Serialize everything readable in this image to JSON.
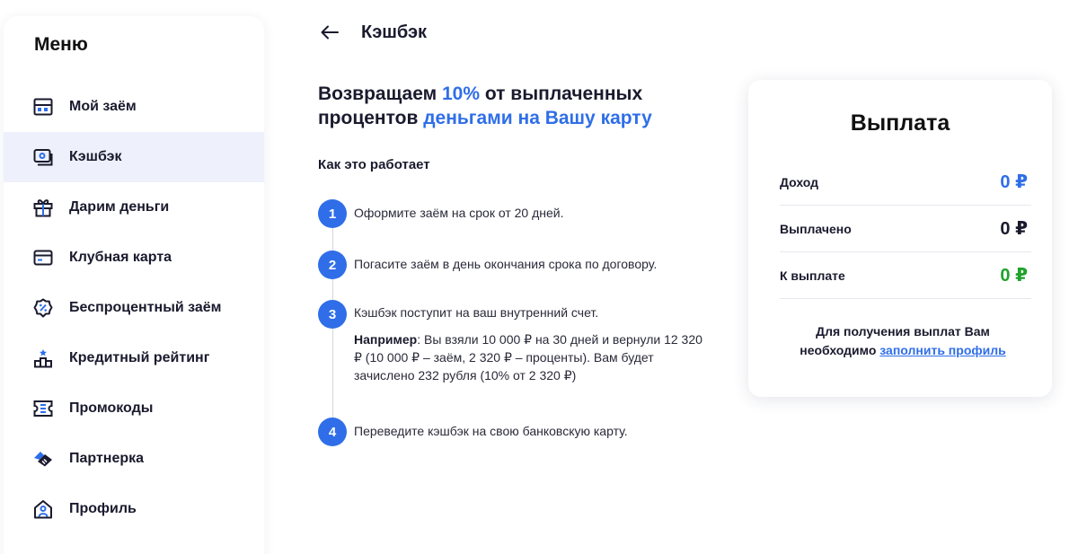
{
  "sidebar": {
    "title": "Меню",
    "items": [
      {
        "label": "Мой заём",
        "icon": "loan-icon",
        "active": false
      },
      {
        "label": "Кэшбэк",
        "icon": "cashback-icon",
        "active": true
      },
      {
        "label": "Дарим деньги",
        "icon": "gift-icon",
        "active": false
      },
      {
        "label": "Клубная карта",
        "icon": "card-icon",
        "active": false
      },
      {
        "label": "Беспроцентный заём",
        "icon": "percent-badge-icon",
        "active": false
      },
      {
        "label": "Кредитный рейтинг",
        "icon": "podium-icon",
        "active": false
      },
      {
        "label": "Промокоды",
        "icon": "ticket-icon",
        "active": false
      },
      {
        "label": "Партнерка",
        "icon": "handshake-icon",
        "active": false
      },
      {
        "label": "Профиль",
        "icon": "profile-house-icon",
        "active": false
      }
    ]
  },
  "header": {
    "title": "Кэшбэк"
  },
  "headline": {
    "part1": "Возвращаем ",
    "accent1": "10%",
    "part2": " от выплаченных процентов ",
    "accent2": "деньгами на Вашу карту"
  },
  "how_it_works": {
    "title": "Как это работает",
    "steps": [
      {
        "number": "1",
        "text": "Оформите заём на срок от 20 дней."
      },
      {
        "number": "2",
        "text": "Погасите заём в день окончания срока по договору."
      },
      {
        "number": "3",
        "text": "Кэшбэк поступит на ваш внутренний счет.",
        "example_label": "Например",
        "example_text": ": Вы взяли 10 000 ₽ на 30 дней и вернули 12 320 ₽ (10 000 ₽ – заём, 2 320 ₽ – проценты). Вам будет зачислено 232 рубля (10% от 2 320 ₽)"
      },
      {
        "number": "4",
        "text": "Переведите кэшбэк на свою банковскую карту."
      }
    ]
  },
  "payout": {
    "title": "Выплата",
    "rows": [
      {
        "label": "Доход",
        "value": "0 ₽",
        "color": "#2f6ee8"
      },
      {
        "label": "Выплачено",
        "value": "0 ₽",
        "color": "#1a1a2e"
      },
      {
        "label": "К выплате",
        "value": "0 ₽",
        "color": "#1fa22a"
      }
    ],
    "note": "Для получения выплат Вам необходимо ",
    "note_link": "заполнить профиль"
  }
}
